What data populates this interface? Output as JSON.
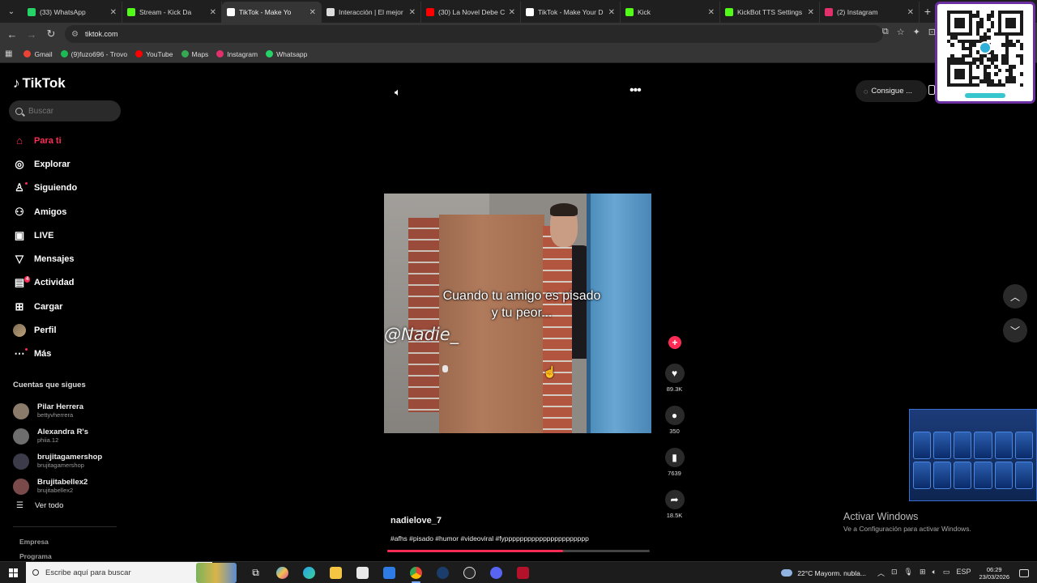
{
  "browser": {
    "tabs": [
      {
        "title": "(33) WhatsApp",
        "color": "#25d366",
        "active": false
      },
      {
        "title": "Stream - Kick Da",
        "color": "#53fc18",
        "active": false
      },
      {
        "title": "TikTok - Make Yo",
        "color": "#ffffff",
        "active": true
      },
      {
        "title": "Interacción | El mejor",
        "color": "#dddddd",
        "active": false
      },
      {
        "title": "(30) La Novel Debe C",
        "color": "#ff0000",
        "active": false
      },
      {
        "title": "TikTok - Make Your D",
        "color": "#ffffff",
        "active": false
      },
      {
        "title": "Kick",
        "color": "#53fc18",
        "active": false
      },
      {
        "title": "KickBot TTS Settings",
        "color": "#53fc18",
        "active": false
      },
      {
        "title": "(2) Instagram",
        "color": "#e1306c",
        "active": false
      }
    ],
    "url": "tiktok.com",
    "bookmarks": [
      {
        "label": "Gmail",
        "color": "#ea4335"
      },
      {
        "label": "(9)fuzo696 - Trovo",
        "color": "#1db954"
      },
      {
        "label": "YouTube",
        "color": "#ff0000"
      },
      {
        "label": "Maps",
        "color": "#34a853"
      },
      {
        "label": "Instagram",
        "color": "#e1306c"
      },
      {
        "label": "Whatsapp",
        "color": "#25d366"
      }
    ]
  },
  "tiktok": {
    "logo": "TikTok",
    "search_placeholder": "Buscar",
    "nav": [
      {
        "label": "Para ti",
        "icon": "home-icon",
        "glyph": "⌂",
        "active": true
      },
      {
        "label": "Explorar",
        "icon": "compass-icon",
        "glyph": "◎"
      },
      {
        "label": "Siguiendo",
        "icon": "following-icon",
        "glyph": "♙"
      },
      {
        "label": "Amigos",
        "icon": "friends-icon",
        "glyph": "⚇"
      },
      {
        "label": "LIVE",
        "icon": "live-icon",
        "glyph": "▣"
      },
      {
        "label": "Mensajes",
        "icon": "messages-icon",
        "glyph": "▽"
      },
      {
        "label": "Actividad",
        "icon": "activity-icon",
        "glyph": "▤",
        "badge": "4"
      },
      {
        "label": "Cargar",
        "icon": "upload-icon",
        "glyph": "⊞"
      },
      {
        "label": "Perfil",
        "icon": "profile-avatar",
        "glyph": ""
      },
      {
        "label": "Más",
        "icon": "more-icon",
        "glyph": "⋯"
      }
    ],
    "following_title": "Cuentas que sigues",
    "following": [
      {
        "name": "Pilar Herrera",
        "user": "bettyvherrera"
      },
      {
        "name": "Alexandra R's",
        "user": "phiia.12"
      },
      {
        "name": "brujitagamershop",
        "user": "brujitagamershop"
      },
      {
        "name": "Brujitabellex2",
        "user": "brujitabellex2"
      }
    ],
    "see_all": "Ver todo",
    "footer": [
      "Empresa",
      "Programa"
    ],
    "get_coins": "Consigue ...",
    "video": {
      "caption_line1": "Cuando tu amigo es pisado",
      "caption_line2": "y tu peor...",
      "watermark": "@Nadie_",
      "progress": 0.67
    },
    "actions": {
      "likes": "89.3K",
      "comments": "350",
      "saves": "7639",
      "shares": "18.5K"
    },
    "author": "nadielove_7",
    "hashtags": "#afhs #pisado #humor #videoviral #fypppppppppppppppppppppp"
  },
  "windows": {
    "activate_title": "Activar Windows",
    "activate_sub": "Ve a Configuración para activar Windows."
  },
  "taskbar": {
    "search_placeholder": "Escribe aquí para buscar",
    "weather": "22°C  Mayorm. nubla...",
    "lang": "ESP",
    "time": "06:29",
    "date": "23/03/2026"
  }
}
